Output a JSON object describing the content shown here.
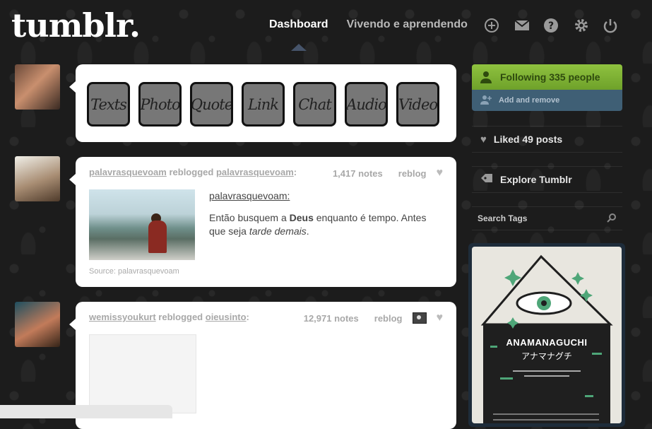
{
  "header": {
    "logo": "tumblr.",
    "nav": {
      "dashboard": "Dashboard",
      "blog": "Vivendo e aprendendo"
    },
    "icons": [
      "plus-circle-icon",
      "mail-icon",
      "help-icon",
      "gear-icon",
      "power-icon"
    ]
  },
  "post_types": [
    "Texts",
    "Photo",
    "Quote",
    "Link",
    "Chat",
    "Audio",
    "Video"
  ],
  "posts": [
    {
      "user": "palavrasquevoam",
      "action": "reblogged",
      "source_user": "palavrasquevoam",
      "notes": "1,417 notes",
      "reblog": "reblog",
      "quote_author": "palavrasquevoam",
      "text_1": "Então busquem a ",
      "text_bold": "Deus",
      "text_2": " enquanto é tempo. Antes que seja ",
      "text_italic": "tarde demais",
      "text_3": ".",
      "source": "Source: palavrasquevoam"
    },
    {
      "user": "wemissyoukurt",
      "action": "reblogged",
      "source_user": "oieusinto",
      "notes": "12,971 notes",
      "reblog": "reblog"
    }
  ],
  "sidebar": {
    "following": "Following 335 people",
    "add_remove": "Add and remove",
    "liked": "Liked 49 posts",
    "explore": "Explore Tumblr",
    "search_tags": "Search Tags"
  },
  "ad": {
    "title": "ANAMANAGUCHI",
    "subtitle": "アナマナグチ"
  },
  "colors": {
    "follow_green": "#7fb236",
    "add_blue": "#3f5f75",
    "background": "#1c1c1c"
  }
}
